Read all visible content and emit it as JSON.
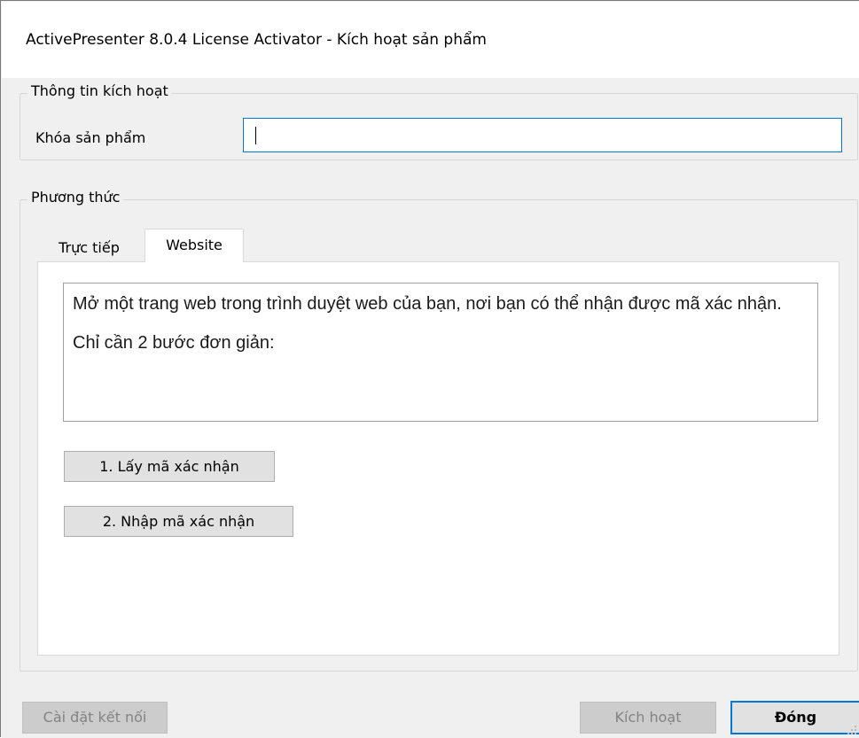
{
  "window": {
    "title": "ActivePresenter 8.0.4 License Activator - Kích hoạt sản phẩm"
  },
  "activation_group": {
    "legend": "Thông tin kích hoạt",
    "product_key_label": "Khóa sản phẩm",
    "product_key_value": ""
  },
  "method_group": {
    "legend": "Phương thức",
    "tabs": [
      {
        "label": "Trực tiếp",
        "selected": false
      },
      {
        "label": "Website",
        "selected": true
      }
    ],
    "website_panel": {
      "description_line1": "Mở một trang web trong trình duyệt web của bạn, nơi bạn có thể nhận được mã xác nhận.",
      "description_line2": "Chỉ cần 2 bước đơn giản:",
      "step1_button": "1. Lấy mã xác nhận",
      "step2_button": "2. Nhập mã xác nhận"
    }
  },
  "footer": {
    "connection_settings_button": "Cài đặt kết nối",
    "activate_button": "Kích hoạt",
    "close_button": "Đóng"
  },
  "colors": {
    "accent": "#0078d7",
    "window_bg": "#f0f0f0",
    "disabled_button_bg": "#cccccc",
    "disabled_text": "#838383"
  }
}
